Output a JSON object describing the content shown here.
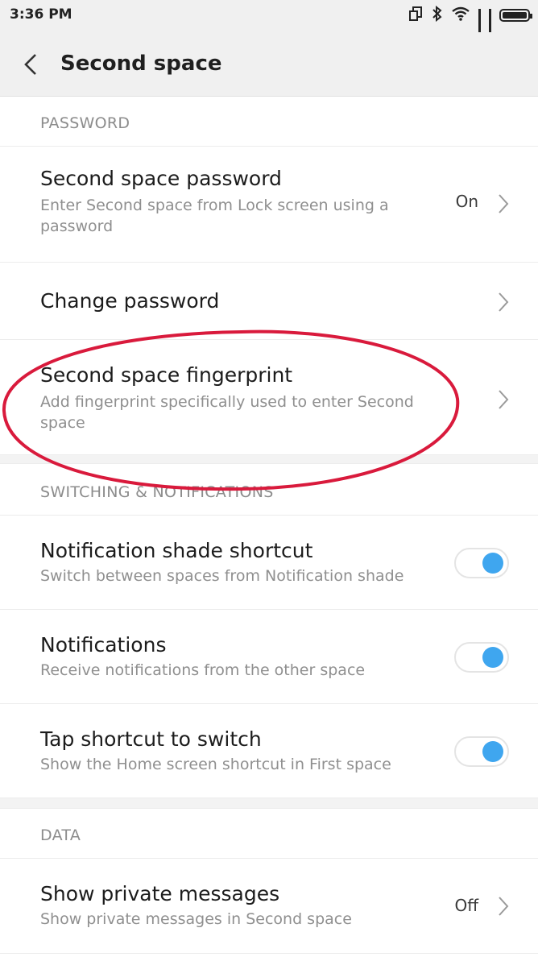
{
  "status_bar": {
    "time": "3:36 PM",
    "icons": [
      "rotate-icon",
      "bluetooth-icon",
      "wifi-icon",
      "signal-icon",
      "signal-icon",
      "battery-icon"
    ]
  },
  "app_bar": {
    "title": "Second space",
    "back_icon": "chevron-left-icon"
  },
  "sections": {
    "password": {
      "header": "PASSWORD",
      "items": [
        {
          "title": "Second space password",
          "subtitle": "Enter Second space from Lock screen using a password",
          "value": "On"
        },
        {
          "title": "Change password"
        },
        {
          "title": "Second space fingerprint",
          "subtitle": "Add fingerprint specifically used to enter Second space"
        }
      ]
    },
    "switching": {
      "header": "SWITCHING & NOTIFICATIONS",
      "items": [
        {
          "title": "Notification shade shortcut",
          "subtitle": "Switch between spaces from Notification shade",
          "enabled": true
        },
        {
          "title": "Notifications",
          "subtitle": "Receive notifications from the other space",
          "enabled": true
        },
        {
          "title": "Tap shortcut to switch",
          "subtitle": "Show the Home screen shortcut in First space",
          "enabled": true
        }
      ]
    },
    "data": {
      "header": "DATA",
      "items": [
        {
          "title": "Show private messages",
          "subtitle": "Show private messages in Second space",
          "value": "Off"
        }
      ]
    }
  },
  "colors": {
    "toggle_on": "#3fa6ef",
    "annotation": "#d91a3c",
    "secondary_text": "#8f8f8f"
  }
}
